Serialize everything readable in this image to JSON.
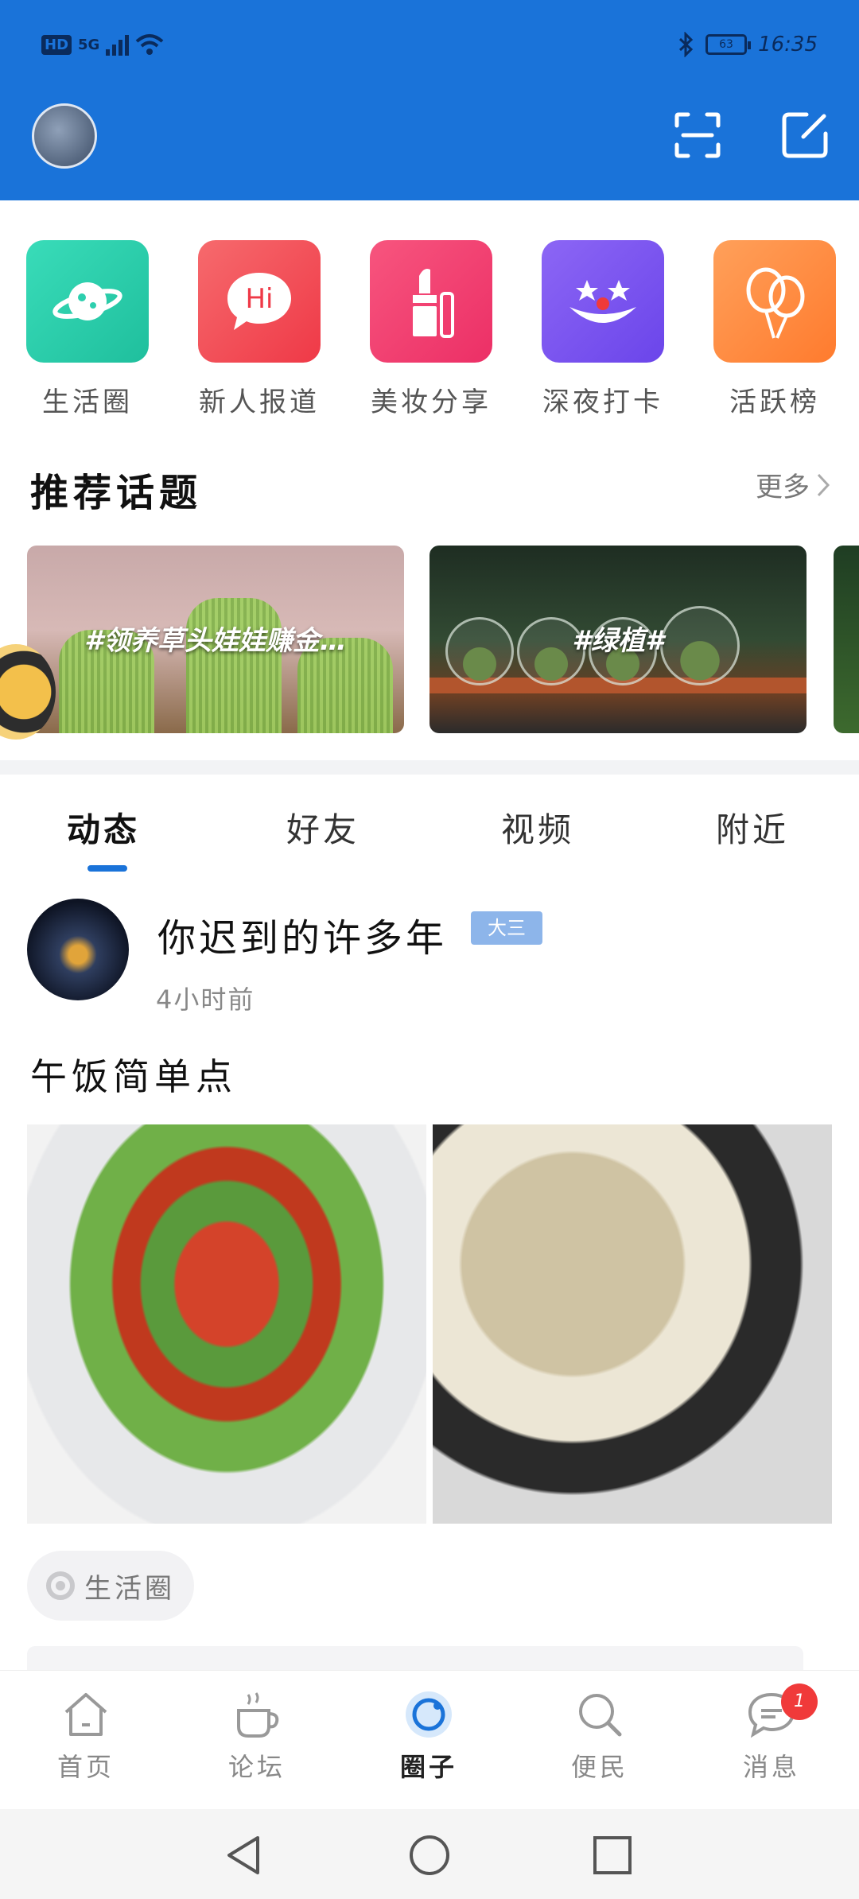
{
  "status": {
    "network": "5G",
    "hd": "HD",
    "battery": "63",
    "time": "16:35"
  },
  "categories": [
    {
      "label": "生活圈",
      "icon": "planet-icon",
      "color": "#2dcfae"
    },
    {
      "label": "新人报道",
      "icon": "hi-bubble-icon",
      "color": "#f3474f"
    },
    {
      "label": "美妆分享",
      "icon": "lipstick-icon",
      "color": "#f13b6e"
    },
    {
      "label": "深夜打卡",
      "icon": "clown-icon",
      "color": "#7a55f0"
    },
    {
      "label": "活跃榜",
      "icon": "balloons-icon",
      "color": "#ff8a3d"
    }
  ],
  "topics": {
    "title": "推荐话题",
    "more": "更多",
    "items": [
      {
        "label": "#领养草头娃娃赚金…"
      },
      {
        "label": "#绿植#"
      }
    ]
  },
  "tabs": [
    "动态",
    "好友",
    "视频",
    "附近"
  ],
  "post": {
    "username": "你迟到的许多年",
    "badge": "大三",
    "time": "4小时前",
    "text": "午饭简单点",
    "circle": "生活圈"
  },
  "bottom_nav": [
    {
      "label": "首页",
      "icon": "home-icon"
    },
    {
      "label": "论坛",
      "icon": "coffee-icon"
    },
    {
      "label": "圈子",
      "icon": "circle-icon",
      "active": true
    },
    {
      "label": "便民",
      "icon": "search-icon"
    },
    {
      "label": "消息",
      "icon": "message-icon",
      "badge": "1"
    }
  ]
}
